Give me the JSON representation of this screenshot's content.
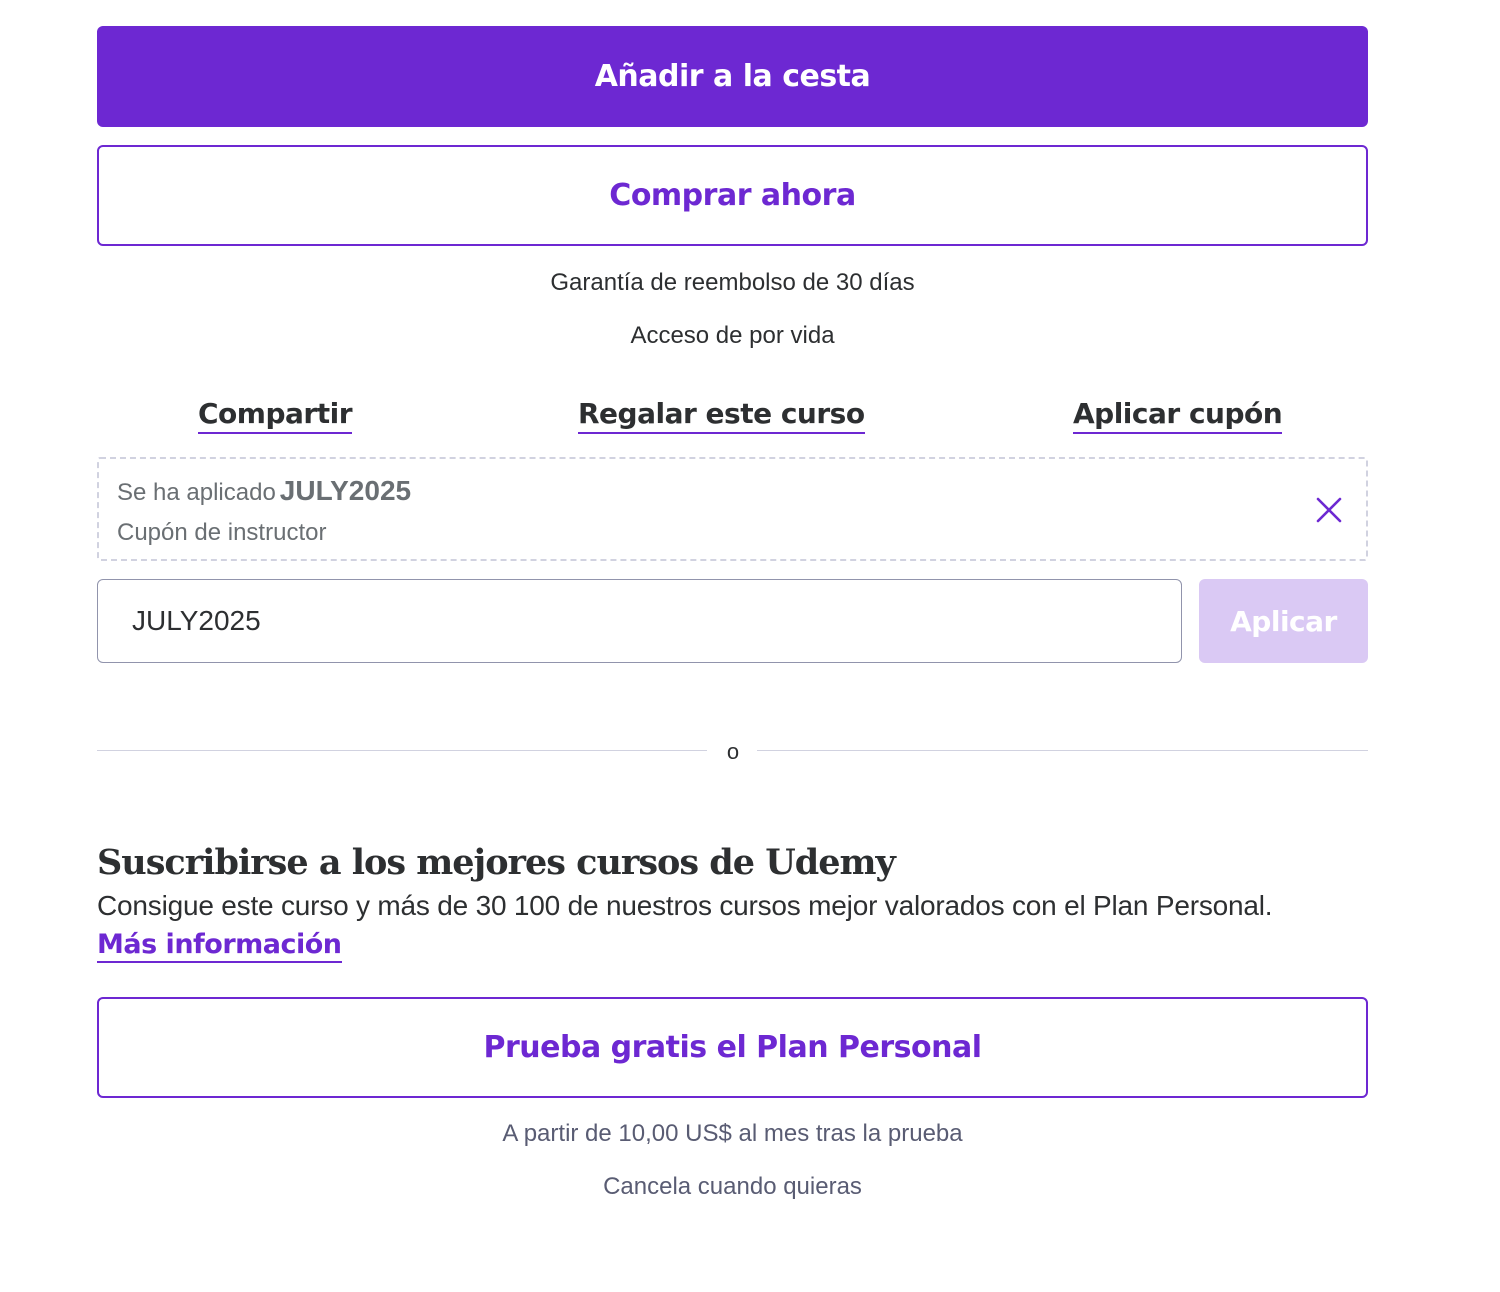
{
  "purchase": {
    "add_to_cart_label": "Añadir a la cesta",
    "buy_now_label": "Comprar ahora",
    "guarantee_text": "Garantía de reembolso de 30 días",
    "access_text": "Acceso de por vida"
  },
  "actions": {
    "share_label": "Compartir",
    "gift_label": "Regalar este curso",
    "coupon_label": "Aplicar cupón"
  },
  "coupon": {
    "applied_prefix": "Se ha aplicado",
    "applied_code": "JULY2025",
    "coupon_type": "Cupón de instructor",
    "input_value": "JULY2025",
    "apply_label": "Aplicar"
  },
  "divider": {
    "text": "o"
  },
  "subscription": {
    "title": "Suscribirse a los mejores cursos de Udemy",
    "description": "Consigue este curso y más de 30 100 de nuestros cursos mejor valorados con el Plan Personal.",
    "more_info_label": "Más información",
    "trial_label": "Prueba gratis el Plan Personal",
    "price_text": "A partir de 10,00 US$ al mes tras la prueba",
    "cancel_text": "Cancela cuando quieras"
  },
  "colors": {
    "brand_purple": "#6d28d2",
    "disabled_purple": "#dac9f4",
    "text_dark": "#2d2f31",
    "text_muted": "#6a6f73"
  },
  "icons": {
    "coupon_remove": "close-icon"
  }
}
